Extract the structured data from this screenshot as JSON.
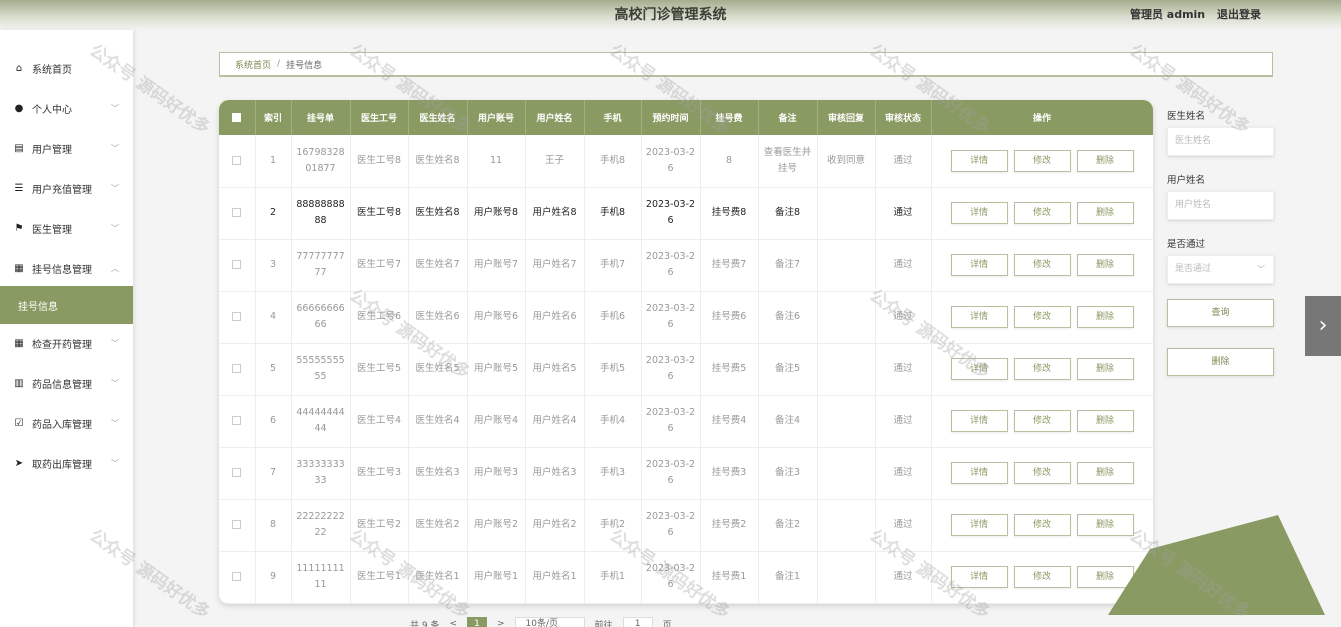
{
  "header": {
    "title": "高校门诊管理系统",
    "user_label": "管理员 admin",
    "logout_label": "退出登录"
  },
  "sidebar": {
    "items": [
      {
        "label": "系统首页",
        "icon": "home-icon",
        "glyph": "⌂",
        "has_chevron": false
      },
      {
        "label": "个人中心",
        "icon": "user-icon",
        "glyph": "●",
        "has_chevron": true
      },
      {
        "label": "用户管理",
        "icon": "document-icon",
        "glyph": "▤",
        "has_chevron": true
      },
      {
        "label": "用户充值管理",
        "icon": "list-icon",
        "glyph": "☰",
        "has_chevron": true
      },
      {
        "label": "医生管理",
        "icon": "flag-icon",
        "glyph": "⚑",
        "has_chevron": true
      },
      {
        "label": "挂号信息管理",
        "icon": "grid-icon",
        "glyph": "▦",
        "has_chevron": true,
        "expanded": true
      },
      {
        "label": "挂号信息",
        "icon": "",
        "glyph": "",
        "has_chevron": false,
        "active": true
      },
      {
        "label": "检查开药管理",
        "icon": "grid-icon",
        "glyph": "▦",
        "has_chevron": true
      },
      {
        "label": "药品信息管理",
        "icon": "bar-chart-icon",
        "glyph": "▥",
        "has_chevron": true
      },
      {
        "label": "药品入库管理",
        "icon": "checkbox-icon",
        "glyph": "☑",
        "has_chevron": true
      },
      {
        "label": "取药出库管理",
        "icon": "send-icon",
        "glyph": "➤",
        "has_chevron": true
      }
    ]
  },
  "breadcrumb": {
    "home": "系统首页",
    "separator": "/",
    "current": "挂号信息"
  },
  "table": {
    "headers": [
      "索引",
      "挂号单",
      "医生工号",
      "医生姓名",
      "用户账号",
      "用户姓名",
      "手机",
      "预约时间",
      "挂号费",
      "备注",
      "审核回复",
      "审核状态",
      "操作"
    ],
    "rows": [
      {
        "index": "1",
        "reg_no": "1679832801877",
        "doc_no": "医生工号8",
        "doc_name": "医生姓名8",
        "user_acct": "11",
        "user_name": "王子",
        "phone": "手机8",
        "time": "2023-03-26",
        "fee": "8",
        "remark": "查看医生并挂号",
        "reply": "收到同意",
        "status": "通过",
        "dark": false
      },
      {
        "index": "2",
        "reg_no": "8888888888",
        "doc_no": "医生工号8",
        "doc_name": "医生姓名8",
        "user_acct": "用户账号8",
        "user_name": "用户姓名8",
        "phone": "手机8",
        "time": "2023-03-26",
        "fee": "挂号费8",
        "remark": "备注8",
        "reply": "",
        "status": "通过",
        "dark": true
      },
      {
        "index": "3",
        "reg_no": "7777777777",
        "doc_no": "医生工号7",
        "doc_name": "医生姓名7",
        "user_acct": "用户账号7",
        "user_name": "用户姓名7",
        "phone": "手机7",
        "time": "2023-03-26",
        "fee": "挂号费7",
        "remark": "备注7",
        "reply": "",
        "status": "通过",
        "dark": false
      },
      {
        "index": "4",
        "reg_no": "6666666666",
        "doc_no": "医生工号6",
        "doc_name": "医生姓名6",
        "user_acct": "用户账号6",
        "user_name": "用户姓名6",
        "phone": "手机6",
        "time": "2023-03-26",
        "fee": "挂号费6",
        "remark": "备注6",
        "reply": "",
        "status": "通过",
        "dark": false
      },
      {
        "index": "5",
        "reg_no": "5555555555",
        "doc_no": "医生工号5",
        "doc_name": "医生姓名5",
        "user_acct": "用户账号5",
        "user_name": "用户姓名5",
        "phone": "手机5",
        "time": "2023-03-26",
        "fee": "挂号费5",
        "remark": "备注5",
        "reply": "",
        "status": "通过",
        "dark": false
      },
      {
        "index": "6",
        "reg_no": "4444444444",
        "doc_no": "医生工号4",
        "doc_name": "医生姓名4",
        "user_acct": "用户账号4",
        "user_name": "用户姓名4",
        "phone": "手机4",
        "time": "2023-03-26",
        "fee": "挂号费4",
        "remark": "备注4",
        "reply": "",
        "status": "通过",
        "dark": false
      },
      {
        "index": "7",
        "reg_no": "3333333333",
        "doc_no": "医生工号3",
        "doc_name": "医生姓名3",
        "user_acct": "用户账号3",
        "user_name": "用户姓名3",
        "phone": "手机3",
        "time": "2023-03-26",
        "fee": "挂号费3",
        "remark": "备注3",
        "reply": "",
        "status": "通过",
        "dark": false
      },
      {
        "index": "8",
        "reg_no": "2222222222",
        "doc_no": "医生工号2",
        "doc_name": "医生姓名2",
        "user_acct": "用户账号2",
        "user_name": "用户姓名2",
        "phone": "手机2",
        "time": "2023-03-26",
        "fee": "挂号费2",
        "remark": "备注2",
        "reply": "",
        "status": "通过",
        "dark": false
      },
      {
        "index": "9",
        "reg_no": "1111111111",
        "doc_no": "医生工号1",
        "doc_name": "医生姓名1",
        "user_acct": "用户账号1",
        "user_name": "用户姓名1",
        "phone": "手机1",
        "time": "2023-03-26",
        "fee": "挂号费1",
        "remark": "备注1",
        "reply": "",
        "status": "通过",
        "dark": false
      }
    ],
    "actions": {
      "detail": "详情",
      "edit": "修改",
      "delete": "删除"
    }
  },
  "filter": {
    "doctor_name_label": "医生姓名",
    "doctor_name_placeholder": "医生姓名",
    "user_name_label": "用户姓名",
    "user_name_placeholder": "用户姓名",
    "approved_label": "是否通过",
    "approved_placeholder": "是否通过",
    "query_button": "查询",
    "delete_button": "删除"
  },
  "pagination": {
    "total": "共 9 条",
    "prev": "<",
    "current_page": "1",
    "next": ">",
    "page_size": "10条/页",
    "goto_label": "前往",
    "goto_value": "1",
    "page_unit": "页"
  },
  "watermark": {
    "text": "公众号 源码好优多"
  },
  "colors": {
    "accent": "#8a9a63",
    "sidebar_active": "#8a9a63"
  }
}
